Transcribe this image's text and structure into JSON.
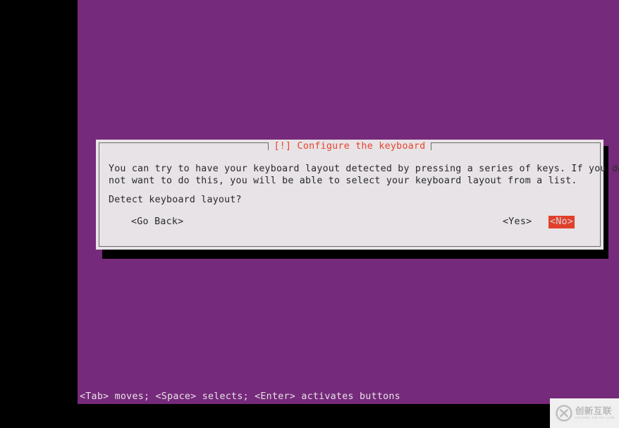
{
  "screen": {
    "background_black": "#000000",
    "console_purple": "#762a7b"
  },
  "dialog": {
    "title": "[!] Configure the keyboard",
    "title_color": "#e8452c",
    "background": "#e7e3e6",
    "border_color": "#6b6a6b",
    "body_line1": "You can try to have your keyboard layout detected by pressing a series of keys. If you do",
    "body_line2": "not want to do this, you will be able to select your keyboard layout from a list.",
    "question": "Detect keyboard layout?",
    "buttons": [
      {
        "label": "<Go Back>",
        "selected": false
      },
      {
        "label": "<Yes>",
        "selected": false
      },
      {
        "label": "<No>",
        "selected": true,
        "highlight_bg": "#e0402c",
        "highlight_fg": "#d9d5d8"
      }
    ]
  },
  "helpbar": {
    "text": "<Tab> moves; <Space> selects; <Enter> activates buttons"
  },
  "watermark": {
    "logo_letter": "X",
    "chinese": "创新互联",
    "pinyin": "CHUANG XIN HU LIAN"
  }
}
